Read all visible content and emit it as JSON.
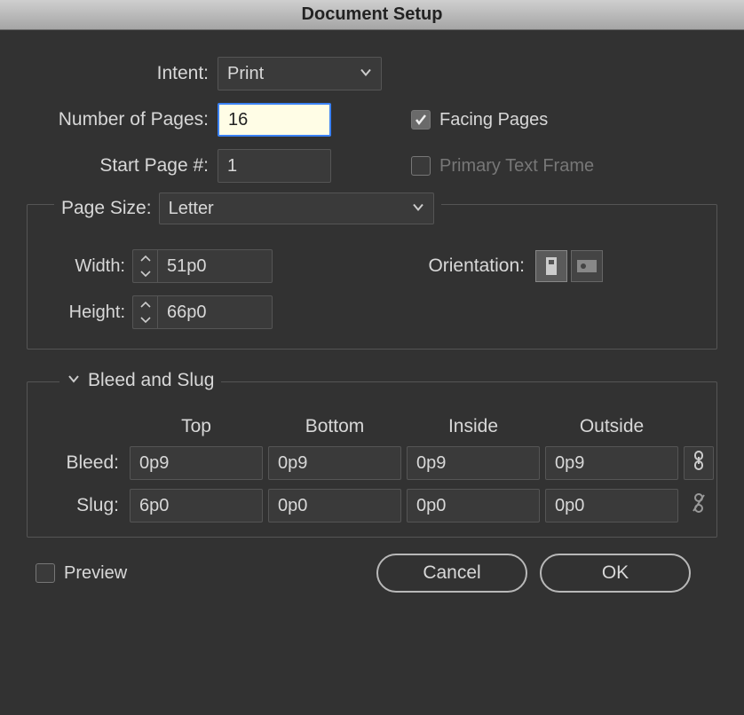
{
  "title": "Document Setup",
  "intent": {
    "label": "Intent:",
    "value": "Print"
  },
  "pages": {
    "numberLabel": "Number of Pages:",
    "numberValue": "16",
    "facingLabel": "Facing Pages",
    "facingChecked": true,
    "startLabel": "Start Page #:",
    "startValue": "1",
    "primaryLabel": "Primary Text Frame",
    "primaryChecked": false
  },
  "pageSize": {
    "label": "Page Size:",
    "value": "Letter",
    "widthLabel": "Width:",
    "widthValue": "51p0",
    "heightLabel": "Height:",
    "heightValue": "66p0",
    "orientationLabel": "Orientation:"
  },
  "bleedSlug": {
    "sectionLabel": "Bleed and Slug",
    "headers": {
      "top": "Top",
      "bottom": "Bottom",
      "inside": "Inside",
      "outside": "Outside"
    },
    "bleed": {
      "label": "Bleed:",
      "top": "0p9",
      "bottom": "0p9",
      "inside": "0p9",
      "outside": "0p9"
    },
    "slug": {
      "label": "Slug:",
      "top": "6p0",
      "bottom": "0p0",
      "inside": "0p0",
      "outside": "0p0"
    }
  },
  "footer": {
    "previewLabel": "Preview",
    "previewChecked": false,
    "cancel": "Cancel",
    "ok": "OK"
  }
}
